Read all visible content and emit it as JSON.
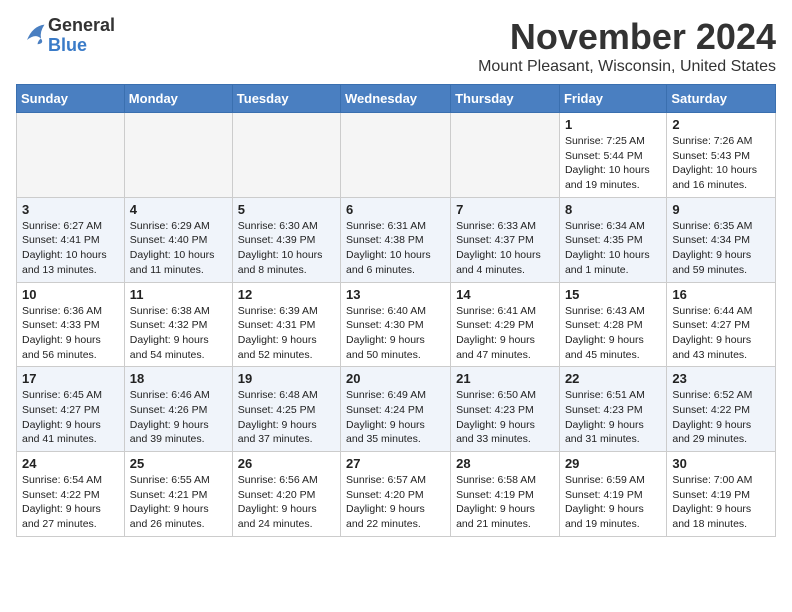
{
  "logo": {
    "general": "General",
    "blue": "Blue"
  },
  "header": {
    "month": "November 2024",
    "location": "Mount Pleasant, Wisconsin, United States"
  },
  "weekdays": [
    "Sunday",
    "Monday",
    "Tuesday",
    "Wednesday",
    "Thursday",
    "Friday",
    "Saturday"
  ],
  "weeks": [
    [
      {
        "day": "",
        "info": "",
        "empty": true
      },
      {
        "day": "",
        "info": "",
        "empty": true
      },
      {
        "day": "",
        "info": "",
        "empty": true
      },
      {
        "day": "",
        "info": "",
        "empty": true
      },
      {
        "day": "",
        "info": "",
        "empty": true
      },
      {
        "day": "1",
        "info": "Sunrise: 7:25 AM\nSunset: 5:44 PM\nDaylight: 10 hours and 19 minutes."
      },
      {
        "day": "2",
        "info": "Sunrise: 7:26 AM\nSunset: 5:43 PM\nDaylight: 10 hours and 16 minutes."
      }
    ],
    [
      {
        "day": "3",
        "info": "Sunrise: 6:27 AM\nSunset: 4:41 PM\nDaylight: 10 hours and 13 minutes."
      },
      {
        "day": "4",
        "info": "Sunrise: 6:29 AM\nSunset: 4:40 PM\nDaylight: 10 hours and 11 minutes."
      },
      {
        "day": "5",
        "info": "Sunrise: 6:30 AM\nSunset: 4:39 PM\nDaylight: 10 hours and 8 minutes."
      },
      {
        "day": "6",
        "info": "Sunrise: 6:31 AM\nSunset: 4:38 PM\nDaylight: 10 hours and 6 minutes."
      },
      {
        "day": "7",
        "info": "Sunrise: 6:33 AM\nSunset: 4:37 PM\nDaylight: 10 hours and 4 minutes."
      },
      {
        "day": "8",
        "info": "Sunrise: 6:34 AM\nSunset: 4:35 PM\nDaylight: 10 hours and 1 minute."
      },
      {
        "day": "9",
        "info": "Sunrise: 6:35 AM\nSunset: 4:34 PM\nDaylight: 9 hours and 59 minutes."
      }
    ],
    [
      {
        "day": "10",
        "info": "Sunrise: 6:36 AM\nSunset: 4:33 PM\nDaylight: 9 hours and 56 minutes."
      },
      {
        "day": "11",
        "info": "Sunrise: 6:38 AM\nSunset: 4:32 PM\nDaylight: 9 hours and 54 minutes."
      },
      {
        "day": "12",
        "info": "Sunrise: 6:39 AM\nSunset: 4:31 PM\nDaylight: 9 hours and 52 minutes."
      },
      {
        "day": "13",
        "info": "Sunrise: 6:40 AM\nSunset: 4:30 PM\nDaylight: 9 hours and 50 minutes."
      },
      {
        "day": "14",
        "info": "Sunrise: 6:41 AM\nSunset: 4:29 PM\nDaylight: 9 hours and 47 minutes."
      },
      {
        "day": "15",
        "info": "Sunrise: 6:43 AM\nSunset: 4:28 PM\nDaylight: 9 hours and 45 minutes."
      },
      {
        "day": "16",
        "info": "Sunrise: 6:44 AM\nSunset: 4:27 PM\nDaylight: 9 hours and 43 minutes."
      }
    ],
    [
      {
        "day": "17",
        "info": "Sunrise: 6:45 AM\nSunset: 4:27 PM\nDaylight: 9 hours and 41 minutes."
      },
      {
        "day": "18",
        "info": "Sunrise: 6:46 AM\nSunset: 4:26 PM\nDaylight: 9 hours and 39 minutes."
      },
      {
        "day": "19",
        "info": "Sunrise: 6:48 AM\nSunset: 4:25 PM\nDaylight: 9 hours and 37 minutes."
      },
      {
        "day": "20",
        "info": "Sunrise: 6:49 AM\nSunset: 4:24 PM\nDaylight: 9 hours and 35 minutes."
      },
      {
        "day": "21",
        "info": "Sunrise: 6:50 AM\nSunset: 4:23 PM\nDaylight: 9 hours and 33 minutes."
      },
      {
        "day": "22",
        "info": "Sunrise: 6:51 AM\nSunset: 4:23 PM\nDaylight: 9 hours and 31 minutes."
      },
      {
        "day": "23",
        "info": "Sunrise: 6:52 AM\nSunset: 4:22 PM\nDaylight: 9 hours and 29 minutes."
      }
    ],
    [
      {
        "day": "24",
        "info": "Sunrise: 6:54 AM\nSunset: 4:22 PM\nDaylight: 9 hours and 27 minutes."
      },
      {
        "day": "25",
        "info": "Sunrise: 6:55 AM\nSunset: 4:21 PM\nDaylight: 9 hours and 26 minutes."
      },
      {
        "day": "26",
        "info": "Sunrise: 6:56 AM\nSunset: 4:20 PM\nDaylight: 9 hours and 24 minutes."
      },
      {
        "day": "27",
        "info": "Sunrise: 6:57 AM\nSunset: 4:20 PM\nDaylight: 9 hours and 22 minutes."
      },
      {
        "day": "28",
        "info": "Sunrise: 6:58 AM\nSunset: 4:19 PM\nDaylight: 9 hours and 21 minutes."
      },
      {
        "day": "29",
        "info": "Sunrise: 6:59 AM\nSunset: 4:19 PM\nDaylight: 9 hours and 19 minutes."
      },
      {
        "day": "30",
        "info": "Sunrise: 7:00 AM\nSunset: 4:19 PM\nDaylight: 9 hours and 18 minutes."
      }
    ]
  ]
}
